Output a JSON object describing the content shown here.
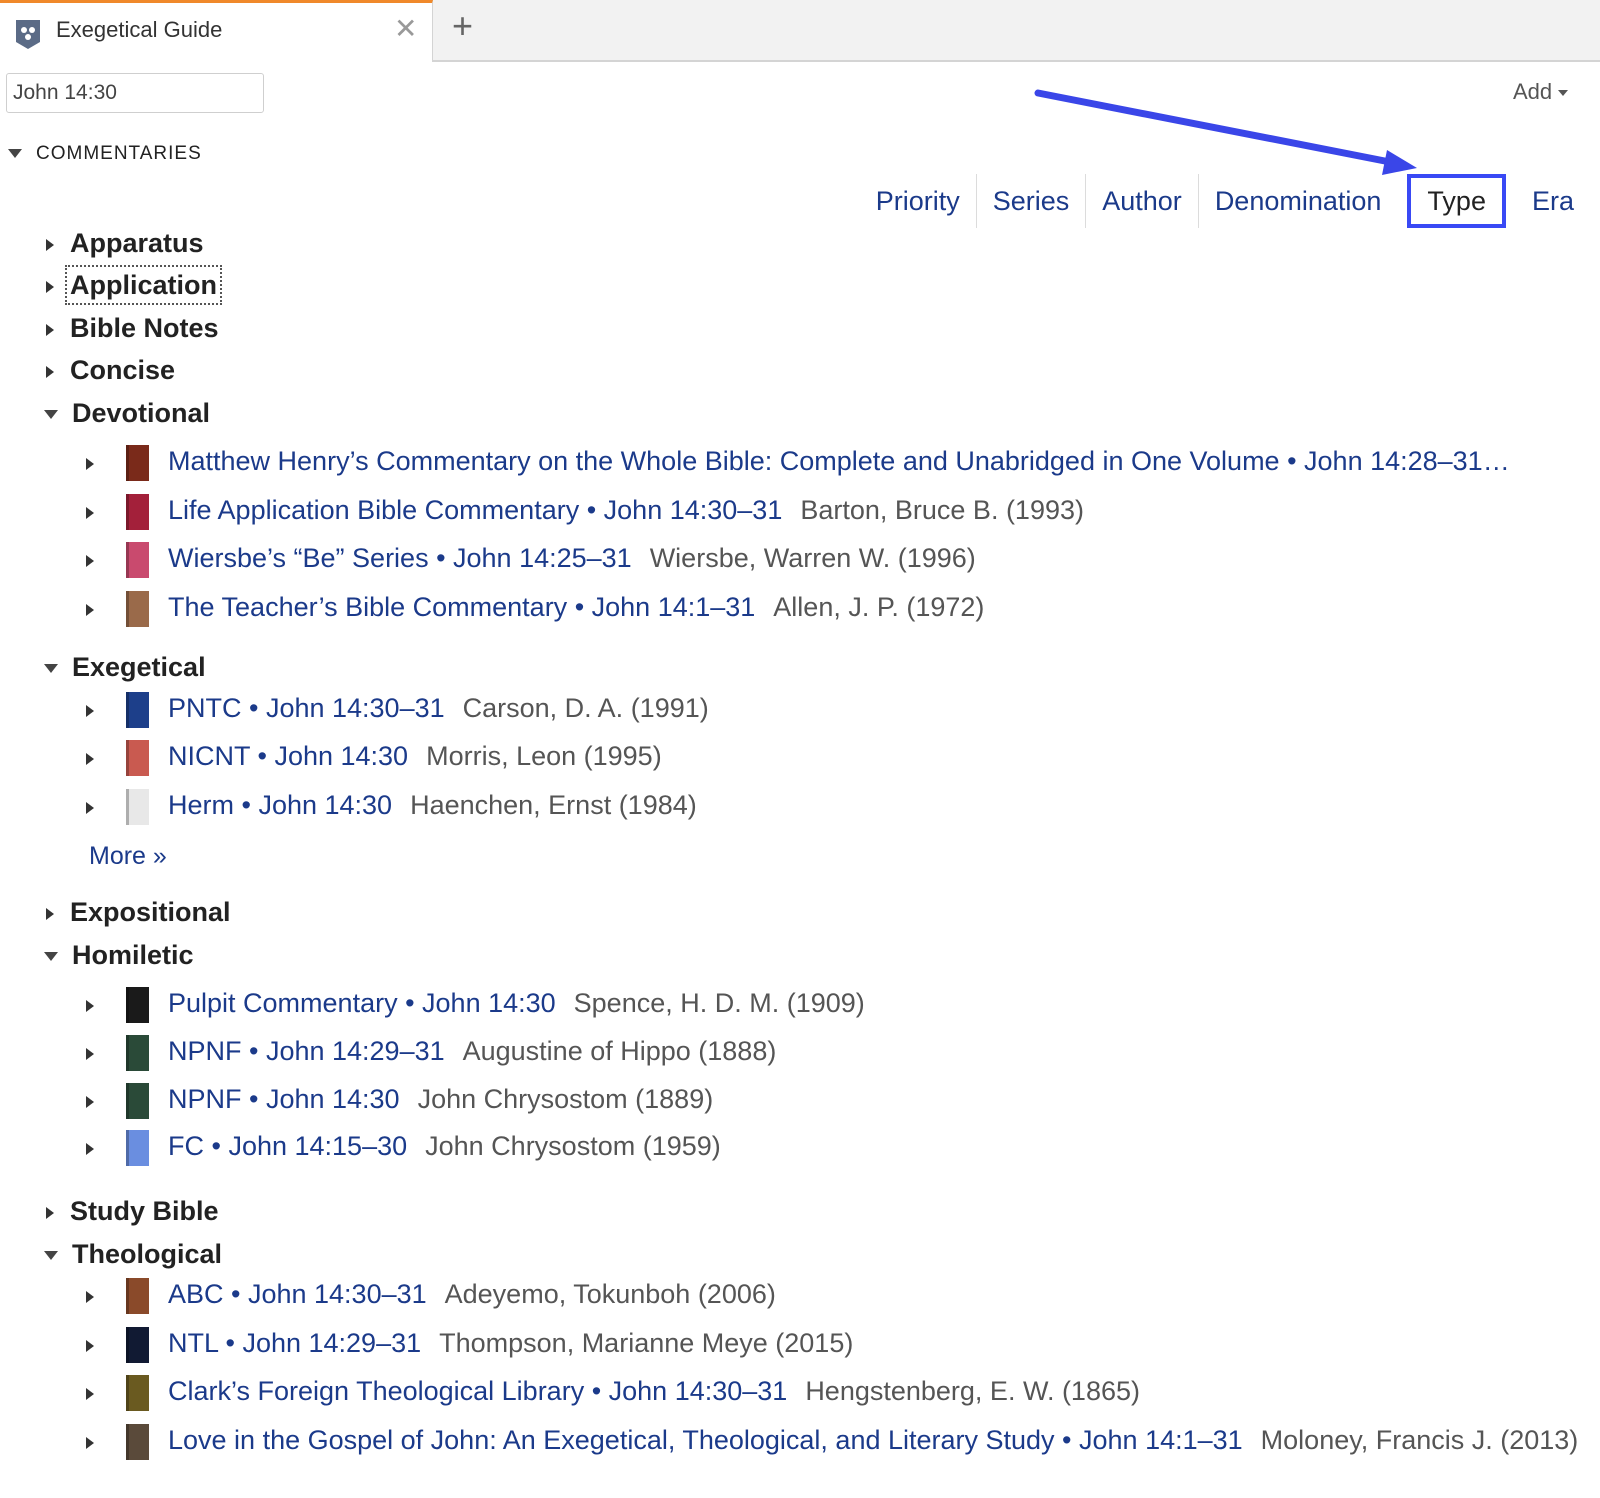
{
  "tab": {
    "title": "Exegetical Guide",
    "close": "✕",
    "add": "+"
  },
  "reference": {
    "value": "John 14:30"
  },
  "add_menu": {
    "label": "Add"
  },
  "section": {
    "title": "COMMENTARIES"
  },
  "sort_tabs": [
    {
      "label": "Priority",
      "active": false
    },
    {
      "label": "Series",
      "active": false
    },
    {
      "label": "Author",
      "active": false
    },
    {
      "label": "Denomination",
      "active": false
    },
    {
      "label": "Type",
      "active": true
    },
    {
      "label": "Era",
      "active": false
    }
  ],
  "colors": {
    "accent_tab": "#f0892a",
    "link": "#1b3a8a",
    "highlight": "#3949f5"
  },
  "categories": [
    {
      "id": "apparatus",
      "label": "Apparatus",
      "expanded": false,
      "focused": false
    },
    {
      "id": "application",
      "label": "Application",
      "expanded": false,
      "focused": true
    },
    {
      "id": "bible-notes",
      "label": "Bible Notes",
      "expanded": false,
      "focused": false
    },
    {
      "id": "concise",
      "label": "Concise",
      "expanded": false,
      "focused": false
    },
    {
      "id": "devotional",
      "label": "Devotional",
      "expanded": true,
      "focused": false,
      "items": [
        {
          "title": "Matthew Henry’s Commentary on the Whole Bible: Complete and Unabridged in One Volume • John 14:28–31…",
          "author": "",
          "cover": "#7a2a1a"
        },
        {
          "title": "Life Application Bible Commentary • John 14:30–31",
          "author": "Barton, Bruce B. (1993)",
          "cover": "#a3203a"
        },
        {
          "title": "Wiersbe’s “Be” Series • John 14:25–31",
          "author": "Wiersbe, Warren W. (1996)",
          "cover": "#c94a6e"
        },
        {
          "title": "The Teacher’s Bible Commentary • John 14:1–31",
          "author": "Allen, J. P. (1972)",
          "cover": "#9a6a4a"
        }
      ]
    },
    {
      "id": "exegetical",
      "label": "Exegetical",
      "expanded": true,
      "focused": false,
      "items": [
        {
          "title": "PNTC • John 14:30–31",
          "author": "Carson, D. A. (1991)",
          "cover": "#1d3f8a"
        },
        {
          "title": "NICNT • John 14:30",
          "author": "Morris, Leon (1995)",
          "cover": "#c95a50"
        },
        {
          "title": "Herm • John 14:30",
          "author": "Haenchen, Ernst (1984)",
          "cover": "#e8e8e8"
        }
      ],
      "more": "More »"
    },
    {
      "id": "expositional",
      "label": "Expositional",
      "expanded": false,
      "focused": false
    },
    {
      "id": "homiletic",
      "label": "Homiletic",
      "expanded": true,
      "focused": false,
      "items": [
        {
          "title": "Pulpit Commentary • John 14:30",
          "author": "Spence, H. D. M. (1909)",
          "cover": "#1a1a1a"
        },
        {
          "title": "NPNF • John 14:29–31",
          "author": "Augustine of Hippo (1888)",
          "cover": "#2a4a38"
        },
        {
          "title": "NPNF • John 14:30",
          "author": "John Chrysostom (1889)",
          "cover": "#2a4a38"
        },
        {
          "title": "FC • John 14:15–30",
          "author": "John Chrysostom (1959)",
          "cover": "#6a8ee0"
        }
      ]
    },
    {
      "id": "study-bible",
      "label": "Study Bible",
      "expanded": false,
      "focused": false
    },
    {
      "id": "theological",
      "label": "Theological",
      "expanded": true,
      "focused": false,
      "items": [
        {
          "title": "ABC • John 14:30–31",
          "author": "Adeyemo, Tokunboh (2006)",
          "cover": "#8a4a2a"
        },
        {
          "title": "NTL • John 14:29–31",
          "author": "Thompson, Marianne Meye (2015)",
          "cover": "#111a33"
        },
        {
          "title": "Clark’s Foreign Theological Library • John 14:30–31",
          "author": "Hengstenberg, E. W. (1865)",
          "cover": "#6a5a20"
        },
        {
          "title": "Love in the Gospel of John: An Exegetical, Theological, and Literary Study • John 14:1–31",
          "author": "Moloney, Francis J. (2013)",
          "cover": "#5a4a3a"
        }
      ]
    }
  ]
}
